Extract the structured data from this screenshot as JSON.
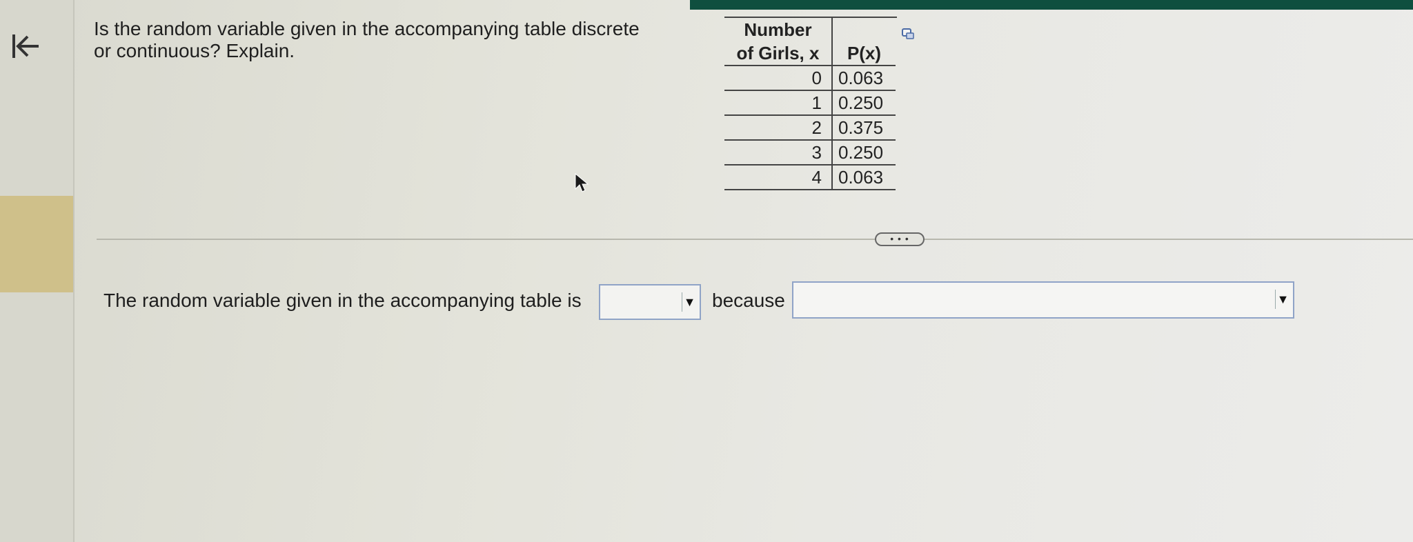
{
  "question": {
    "line1": "Is the random variable given in the accompanying table discrete",
    "line2": "or continuous? Explain."
  },
  "table": {
    "header_x_line1": "Number",
    "header_x_line2": "of Girls, x",
    "header_p": "P(x)",
    "rows": [
      {
        "x": "0",
        "p": "0.063"
      },
      {
        "x": "1",
        "p": "0.250"
      },
      {
        "x": "2",
        "p": "0.375"
      },
      {
        "x": "3",
        "p": "0.250"
      },
      {
        "x": "4",
        "p": "0.063"
      }
    ]
  },
  "more_button": {
    "label": "• • •"
  },
  "answer": {
    "prefix": "The random variable given in the accompanying table is",
    "middle": "because",
    "select1_value": "",
    "select2_value": "",
    "arrow_glyph": "▼"
  },
  "icons": {
    "back": "back-to-start-icon",
    "copy": "copy-icon",
    "cursor": "mouse-cursor-icon"
  },
  "colors": {
    "top_strip": "#0f4f3f",
    "left_accent": "#cfc08a",
    "select_border": "#8fa3c7"
  }
}
